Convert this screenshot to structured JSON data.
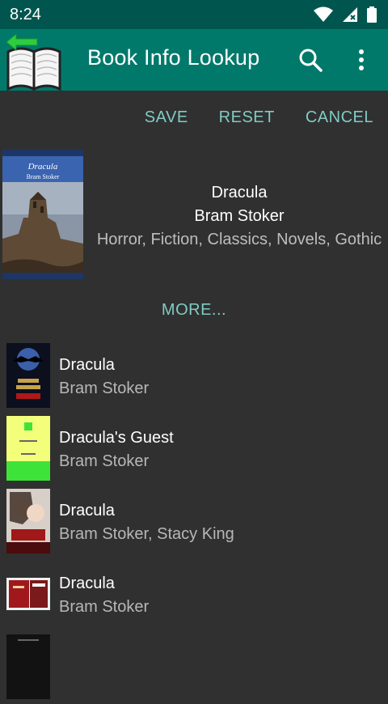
{
  "status_bar": {
    "time": "8:24"
  },
  "app_bar": {
    "title": "Book Info Lookup"
  },
  "actions": {
    "save": "SAVE",
    "reset": "RESET",
    "cancel": "CANCEL"
  },
  "selected_book": {
    "title": "Dracula",
    "author": "Bram Stoker",
    "genres": "Horror, Fiction, Classics, Novels, Gothic",
    "cover": {
      "title": "Dracula",
      "author": "Bram Stoker"
    }
  },
  "more_label": "MORE...",
  "results": [
    {
      "title": "Dracula",
      "author": "Bram Stoker"
    },
    {
      "title": "Dracula's Guest",
      "author": "Bram Stoker"
    },
    {
      "title": "Dracula",
      "author": "Bram Stoker, Stacy King"
    },
    {
      "title": "Dracula",
      "author": "Bram Stoker"
    }
  ],
  "colors": {
    "status_bar": "#00564f",
    "app_bar": "#00796b",
    "accent": "#80cbc4",
    "background": "#303030"
  }
}
